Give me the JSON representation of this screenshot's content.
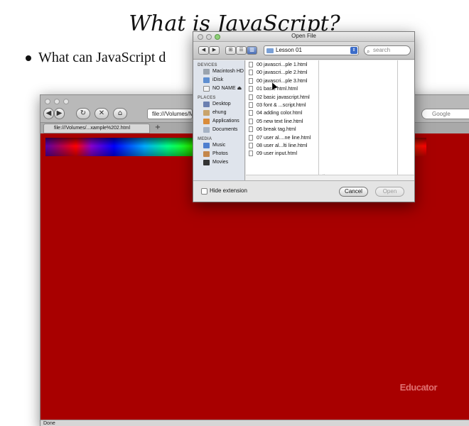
{
  "slide": {
    "title": "What is JavaScript?",
    "bullet_text": "What can JavaScript d"
  },
  "browser": {
    "address": "file:///Volumes/M",
    "search_placeholder": "Google",
    "tab_title": "file:///Volumes/...xample%202.html",
    "tab_add": "+",
    "status": "Done",
    "watermark": "Educator",
    "page_background": "#a80000",
    "nav": {
      "back": "◀",
      "forward": "▶",
      "reload": "↻",
      "stop": "✕",
      "home": "⌂"
    }
  },
  "dialog": {
    "title": "Open File",
    "location": "Lesson 01",
    "search_placeholder": "search",
    "nav": {
      "back": "◀",
      "forward": "▶"
    },
    "view_modes": [
      "⊞",
      "☰",
      "▥"
    ],
    "sidebar": {
      "devices_header": "DEVICES",
      "devices": [
        "Macintosh HD",
        "iDisk",
        "NO NAME"
      ],
      "eject": "⏏",
      "places_header": "PLACES",
      "places": [
        "Desktop",
        "ehung",
        "Applications",
        "Documents"
      ],
      "media_header": "MEDIA",
      "media": [
        "Music",
        "Photos",
        "Movies"
      ]
    },
    "files": [
      "00 javascri...ple 1.html",
      "00 javascri...ple 2.html",
      "00 javascri...ple 3.html",
      "01 basic html.html",
      "02 basic javascript.html",
      "03 font & ...script.html",
      "04 adding color.html",
      "05 new text line.html",
      "06 break tag.html",
      "07 user al....ne line.html",
      "08 user al...lti line.html",
      "09 user input.html"
    ],
    "column_tick": "II",
    "hide_extension_label": "Hide extension",
    "cancel_label": "Cancel",
    "open_label": "Open"
  }
}
